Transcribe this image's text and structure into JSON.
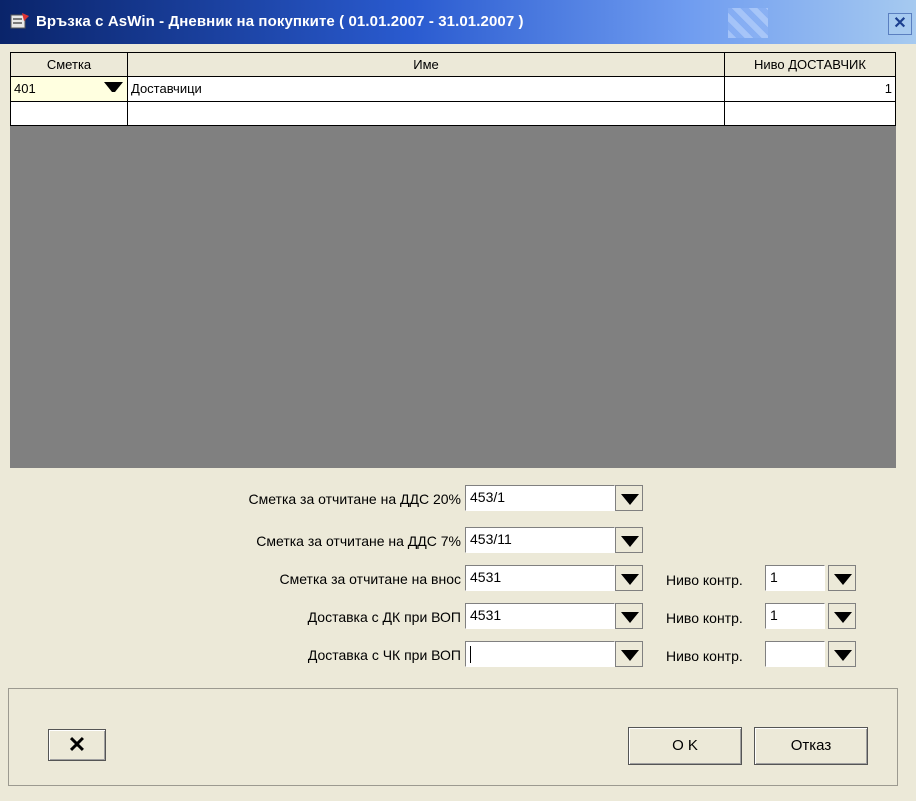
{
  "window": {
    "title": "Връзка с AsWin - Дневник на покупките ( 01.01.2007 - 31.01.2007 )"
  },
  "grid": {
    "columns": [
      "Сметка",
      "Име",
      "Ниво ДОСТАВЧИК"
    ],
    "rows": [
      {
        "account": "401",
        "name": "Доставчици",
        "level": "1"
      }
    ]
  },
  "form": {
    "vat20": {
      "label": "Сметка за отчитане на ДДС  20%",
      "value": "453/1"
    },
    "vat7": {
      "label": "Сметка за отчитане на ДДС  7%",
      "value": "453/11"
    },
    "import": {
      "label": "Сметка за отчитане на внос",
      "value": "4531",
      "level_label": "Ниво контр.",
      "level_value": "1"
    },
    "dk_vop": {
      "label": "Доставка с ДК при ВОП",
      "value": "4531",
      "level_label": "Ниво контр.",
      "level_value": "1"
    },
    "chk_vop": {
      "label": "Доставка с ЧК при ВОП",
      "value": "",
      "level_label": "Ниво контр.",
      "level_value": ""
    }
  },
  "buttons": {
    "delete_glyph": "✕",
    "ok": "O K",
    "cancel": "Отказ"
  },
  "icons": {
    "close": "close-icon",
    "dropdown": "chevron-down-icon",
    "app": "app-icon"
  }
}
